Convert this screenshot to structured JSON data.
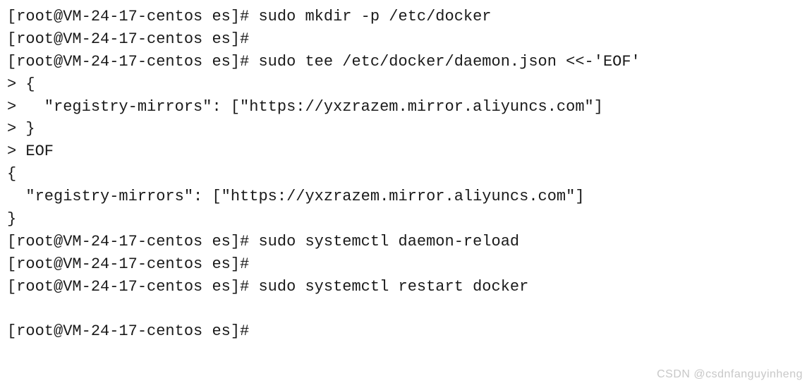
{
  "terminal": {
    "lines": [
      "[root@VM-24-17-centos es]# sudo mkdir -p /etc/docker",
      "[root@VM-24-17-centos es]#",
      "[root@VM-24-17-centos es]# sudo tee /etc/docker/daemon.json <<-'EOF'",
      "> {",
      ">   \"registry-mirrors\": [\"https://yxzrazem.mirror.aliyuncs.com\"]",
      "> }",
      "> EOF",
      "{",
      "  \"registry-mirrors\": [\"https://yxzrazem.mirror.aliyuncs.com\"]",
      "}",
      "[root@VM-24-17-centos es]# sudo systemctl daemon-reload",
      "[root@VM-24-17-centos es]#",
      "[root@VM-24-17-centos es]# sudo systemctl restart docker",
      "",
      "[root@VM-24-17-centos es]#"
    ]
  },
  "watermark": "CSDN @csdnfanguyinheng"
}
